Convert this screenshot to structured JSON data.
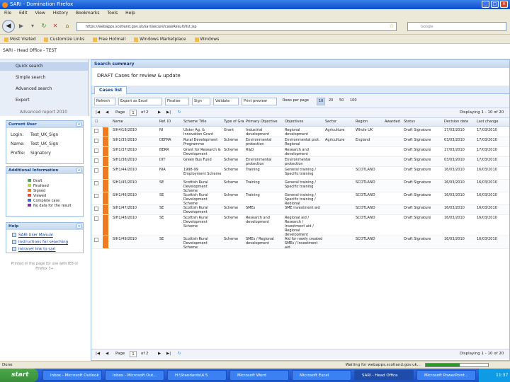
{
  "window": {
    "title": "SARI - Domination Firefox"
  },
  "menu": [
    "File",
    "Edit",
    "View",
    "History",
    "Bookmarks",
    "Tools",
    "Help"
  ],
  "nav": {
    "url": "https://webapps.scotland.gov.uk/sari/secure/caseResult/list.jsp",
    "search_placeholder": "Google"
  },
  "bookmarks": [
    "Most Visited",
    "Customize Links",
    "Free Hotmail",
    "Windows Marketplace",
    "Windows"
  ],
  "tab": {
    "title": "SARI - Head Office - TEST"
  },
  "sidebar": {
    "links": [
      "Quick search",
      "Simple search",
      "Advanced search",
      "Export",
      "Advanced report 2010"
    ],
    "current_user": {
      "header": "Current User",
      "login_label": "Login:",
      "login": "Test_UK_Sign",
      "name_label": "Name:",
      "name": "Test_UK_Sign",
      "profile_label": "Profile:",
      "profile": "Signatory"
    },
    "additional": {
      "header": "Additional Information",
      "legend": [
        {
          "label": "Draft",
          "color": "#4aa84a"
        },
        {
          "label": "Finalised",
          "color": "#b5d34a"
        },
        {
          "label": "Signed",
          "color": "#f07a20"
        },
        {
          "label": "Viewed",
          "color": "#e84a4a"
        },
        {
          "label": "Complete case",
          "color": "#3a6ad4"
        },
        {
          "label": "No data for the result",
          "color": "#8a2ab0"
        }
      ]
    },
    "help": {
      "header": "Help",
      "links": [
        "SARI User Manual",
        "Instructions for searching",
        "Intranet link to sari"
      ]
    },
    "footer": "Printed in the page for use with IE8 or Firefox 3+"
  },
  "main": {
    "header": "Search summary",
    "title": "DRAFT Cases for review & update",
    "tab": "Cases list",
    "toolbar": {
      "buttons": [
        "Refresh",
        "Export as Excel",
        "Finalise",
        "Sign",
        "Validate",
        "Print preview"
      ],
      "show_label": "Rows per page",
      "page_sizes": [
        "10",
        "20",
        "50",
        "100"
      ]
    },
    "pager": {
      "page_label": "Page",
      "page": "1",
      "of_label": "of 2",
      "displaying": "Displaying 1 - 10 of 20"
    },
    "columns": [
      "Name",
      "Ref. ID",
      "Scheme Title",
      "Type of Grant",
      "Primary Objective",
      "Objectives",
      "Sector",
      "Region",
      "Awarded",
      "Status",
      "Decision date",
      "Last change"
    ],
    "rows": [
      [
        "SIH4/18/2010",
        "NI",
        "Ulster Ag. & Innovation Grant",
        "Grant",
        "Industrial development",
        "Regional development",
        "Agriculture",
        "Whole UK",
        "",
        "Draft Signature",
        "17/03/2010",
        "17/03/2010"
      ],
      [
        "SIH1/35/2010",
        "DEFRA",
        "Rural Development Programme",
        "Scheme",
        "Environmental protection",
        "Environmental prot. Regional",
        "Agriculture",
        "England",
        "",
        "Draft Signature",
        "03/03/2010",
        "17/03/2010"
      ],
      [
        "SIH1/37/2010",
        "BERR",
        "Grant for Research & Development",
        "Scheme",
        "R&D",
        "Research and development",
        "",
        "",
        "",
        "Draft Signature",
        "17/03/2010",
        "17/03/2010"
      ],
      [
        "SIH1/38/2010",
        "DIT",
        "Green Bus Fund",
        "Scheme",
        "Environmental protection",
        "Environmental protection",
        "",
        "",
        "",
        "Draft Signature",
        "03/03/2010",
        "17/03/2010"
      ],
      [
        "SIH1/44/2010",
        "NIA",
        "1998-99 Employment Scheme",
        "Scheme",
        "Training",
        "General training / Specific training",
        "",
        "SCOTLAND",
        "",
        "Draft Signature",
        "16/03/2010",
        "16/03/2010"
      ],
      [
        "SIH1/45/2010",
        "SE",
        "Scottish Rural Development Scheme",
        "Scheme",
        "Training",
        "General training / Specific training",
        "",
        "SCOTLAND",
        "",
        "Draft Signature",
        "16/03/2010",
        "16/03/2010"
      ],
      [
        "SIH1/46/2010",
        "SE",
        "Scottish Rural Development Scheme",
        "Scheme",
        "Training",
        "General training / Specific training / Regional",
        "",
        "SCOTLAND",
        "",
        "Draft Signature",
        "16/03/2010",
        "16/03/2010"
      ],
      [
        "SIH1/47/2010",
        "SE",
        "Scottish Rural Development Scheme",
        "Scheme",
        "SMEs",
        "SME investment aid",
        "",
        "SCOTLAND",
        "",
        "Draft Signature",
        "16/03/2010",
        "16/03/2010"
      ],
      [
        "SIH1/48/2010",
        "SE",
        "Scottish Rural Development Scheme",
        "Scheme",
        "Research and development",
        "Regional aid / Research / Investment aid / Regional development",
        "",
        "SCOTLAND",
        "",
        "Draft Signature",
        "16/03/2010",
        "16/03/2010"
      ],
      [
        "SIH1/49/2010",
        "SE",
        "Scottish Rural Development Scheme",
        "Scheme",
        "SMEs / Regional development",
        "Aid for newly created SMEs / Investment aid",
        "",
        "SCOTLAND",
        "",
        "Draft Signature",
        "16/03/2010",
        "16/03/2010"
      ]
    ],
    "bottom_pager": {
      "page_label": "Page",
      "page": "1",
      "of_label": "of 2",
      "displaying": "Displaying 1 - 10 of 20"
    }
  },
  "status": {
    "text": "Done",
    "right": "Waiting for webapps.scotland.gov.uk..."
  },
  "taskbar": {
    "start": "start",
    "tasks": [
      "Inbox - Microsoft Outlook",
      "Inbox - Microsoft Out...",
      "H:\\Standards\\4.5",
      "Microsoft Word",
      "Microsoft Excel",
      "SARI - Head Office",
      "Microsoft PowerPoint..."
    ],
    "clock": "11:37"
  }
}
